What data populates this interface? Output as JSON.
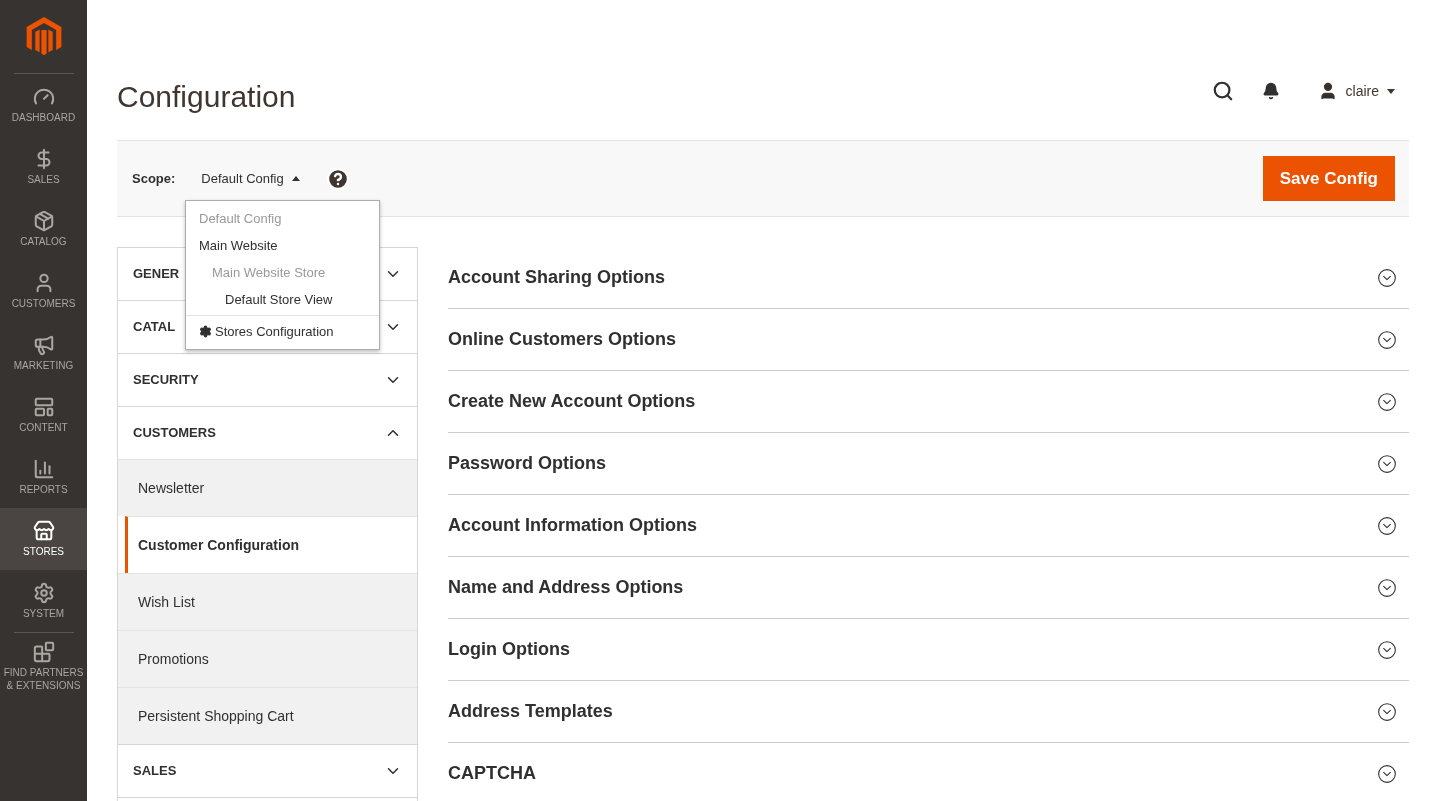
{
  "sidebar": {
    "items": [
      {
        "label": "DASHBOARD",
        "selected": false
      },
      {
        "label": "SALES",
        "selected": false
      },
      {
        "label": "CATALOG",
        "selected": false
      },
      {
        "label": "CUSTOMERS",
        "selected": false
      },
      {
        "label": "MARKETING",
        "selected": false
      },
      {
        "label": "CONTENT",
        "selected": false
      },
      {
        "label": "REPORTS",
        "selected": false
      },
      {
        "label": "STORES",
        "selected": true
      },
      {
        "label": "SYSTEM",
        "selected": false
      },
      {
        "label": "FIND PARTNERS & EXTENSIONS",
        "selected": false
      }
    ]
  },
  "page_title": "Configuration",
  "header": {
    "user": "claire"
  },
  "scope": {
    "label": "Scope:",
    "value": "Default Config",
    "menu": [
      {
        "label": "Default Config",
        "kind": "website-group",
        "disabled": true
      },
      {
        "label": "Main Website",
        "kind": "website",
        "disabled": false
      },
      {
        "label": "Main Website Store",
        "kind": "store",
        "disabled": true
      },
      {
        "label": "Default Store View",
        "kind": "view",
        "disabled": false
      },
      {
        "label": "Stores Configuration",
        "kind": "link",
        "disabled": false
      }
    ]
  },
  "save_button": "Save Config",
  "config_nav": [
    {
      "label": "GENER",
      "expanded": false
    },
    {
      "label": "CATAL",
      "expanded": false
    },
    {
      "label": "SECURITY",
      "expanded": false
    },
    {
      "label": "CUSTOMERS",
      "expanded": true,
      "children": [
        {
          "label": "Newsletter",
          "selected": false
        },
        {
          "label": "Customer Configuration",
          "selected": true
        },
        {
          "label": "Wish List",
          "selected": false
        },
        {
          "label": "Promotions",
          "selected": false
        },
        {
          "label": "Persistent Shopping Cart",
          "selected": false
        }
      ]
    },
    {
      "label": "SALES",
      "expanded": false
    }
  ],
  "sections": [
    {
      "title": "Account Sharing Options",
      "expanded": false
    },
    {
      "title": "Online Customers Options",
      "expanded": false
    },
    {
      "title": "Create New Account Options",
      "expanded": false
    },
    {
      "title": "Password Options",
      "expanded": false
    },
    {
      "title": "Account Information Options",
      "expanded": false
    },
    {
      "title": "Name and Address Options",
      "expanded": false
    },
    {
      "title": "Login Options",
      "expanded": false
    },
    {
      "title": "Address Templates",
      "expanded": false
    },
    {
      "title": "CAPTCHA",
      "expanded": false
    }
  ]
}
